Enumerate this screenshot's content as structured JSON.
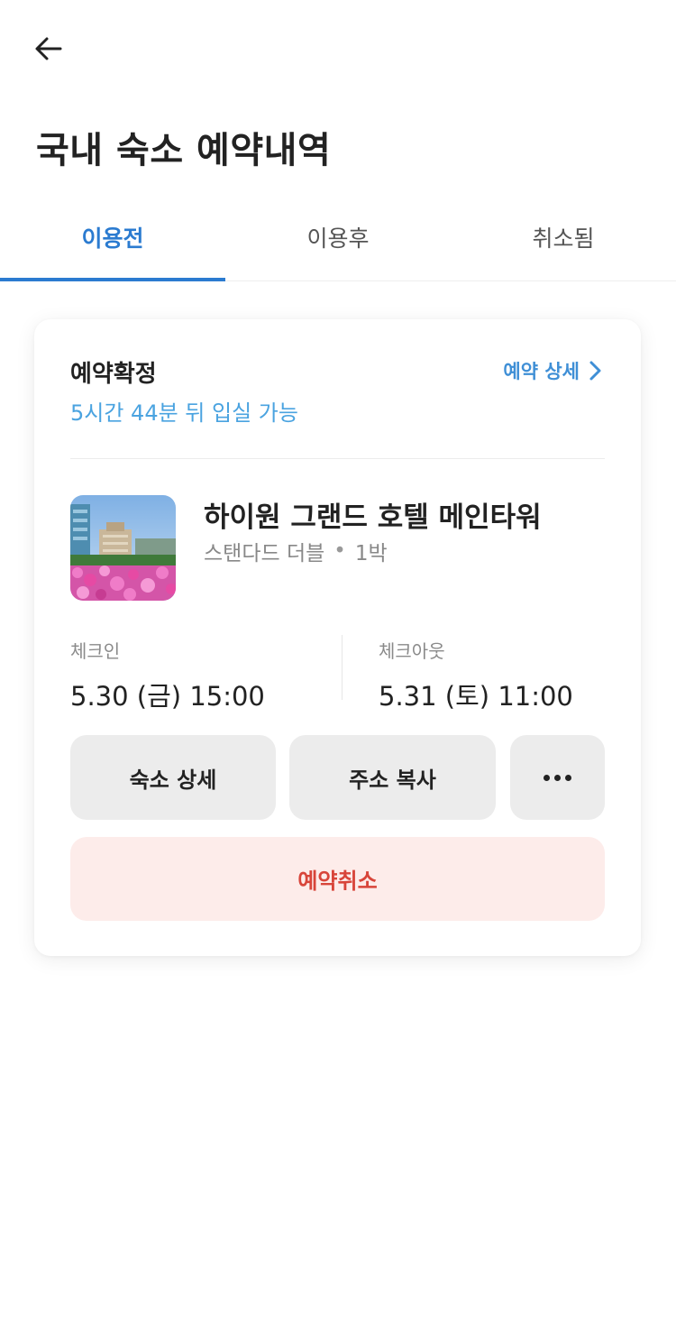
{
  "header": {
    "back_icon": "arrow-left-icon",
    "title": "국내 숙소 예약내역"
  },
  "tabs": [
    {
      "label": "이용전",
      "active": true
    },
    {
      "label": "이용후",
      "active": false
    },
    {
      "label": "취소됨",
      "active": false
    }
  ],
  "reservation": {
    "status": "예약확정",
    "checkin_countdown": "5시간 44분 뒤 입실 가능",
    "detail_link": "예약 상세",
    "detail_link_icon": "chevron-right-icon",
    "hotel_name": "하이원 그랜드 호텔 메인타워",
    "room_type": "스탠다드 더블",
    "separator": "•",
    "nights": "1박",
    "checkin_label": "체크인",
    "checkin_value": "5.30 (금) 15:00",
    "checkout_label": "체크아웃",
    "checkout_value": "5.31 (토) 11:00"
  },
  "actions": {
    "property_detail": "숙소 상세",
    "copy_address": "주소 복사",
    "more_icon": "more-horizontal-icon",
    "cancel": "예약취소"
  },
  "colors": {
    "accent": "#2b7bd0",
    "countdown": "#4aa3e0",
    "cancel_text": "#d8453a",
    "cancel_bg": "#fdecea",
    "button_bg": "#ececec"
  }
}
